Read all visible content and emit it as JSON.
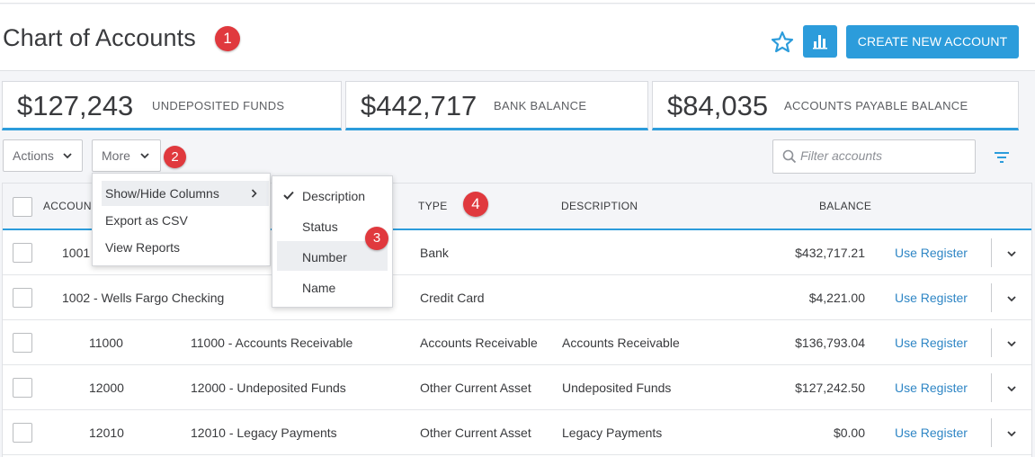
{
  "header": {
    "title": "Chart of Accounts",
    "create_label": "CREATE NEW ACCOUNT",
    "accent": "#2c9cdb"
  },
  "annotations": [
    "1",
    "2",
    "3",
    "4"
  ],
  "kpis": [
    {
      "amount": "$127,243",
      "label": "UNDEPOSITED FUNDS"
    },
    {
      "amount": "$442,717",
      "label": "BANK BALANCE"
    },
    {
      "amount": "$84,035",
      "label": "ACCOUNTS PAYABLE BALANCE"
    }
  ],
  "toolbar": {
    "actions_label": "Actions",
    "more_label": "More",
    "filter_placeholder": "Filter accounts"
  },
  "more_menu": [
    "Show/Hide Columns",
    "Export as CSV",
    "View Reports"
  ],
  "columns_menu": [
    {
      "label": "Description",
      "checked": true
    },
    {
      "label": "Status",
      "checked": false
    },
    {
      "label": "Number",
      "checked": false
    },
    {
      "label": "Name",
      "checked": false
    }
  ],
  "table": {
    "headers": {
      "account": "ACCOUNT",
      "type": "TYPE",
      "description": "DESCRIPTION",
      "balance": "BALANCE"
    },
    "action_label": "Use Register",
    "rows": [
      {
        "number": "",
        "name": "1001",
        "type": "Bank",
        "description": "",
        "balance": "$432,717.21"
      },
      {
        "number": "",
        "name": "1002 - Wells Fargo Checking",
        "type": "Credit Card",
        "description": "",
        "balance": "$4,221.00"
      },
      {
        "number": "11000",
        "name": "11000 - Accounts Receivable",
        "type": "Accounts Receivable",
        "description": "Accounts Receivable",
        "balance": "$136,793.04"
      },
      {
        "number": "12000",
        "name": "12000 - Undeposited Funds",
        "type": "Other Current Asset",
        "description": "Undeposited Funds",
        "balance": "$127,242.50"
      },
      {
        "number": "12010",
        "name": "12010 - Legacy Payments",
        "type": "Other Current Asset",
        "description": "Legacy Payments",
        "balance": "$0.00"
      }
    ]
  }
}
